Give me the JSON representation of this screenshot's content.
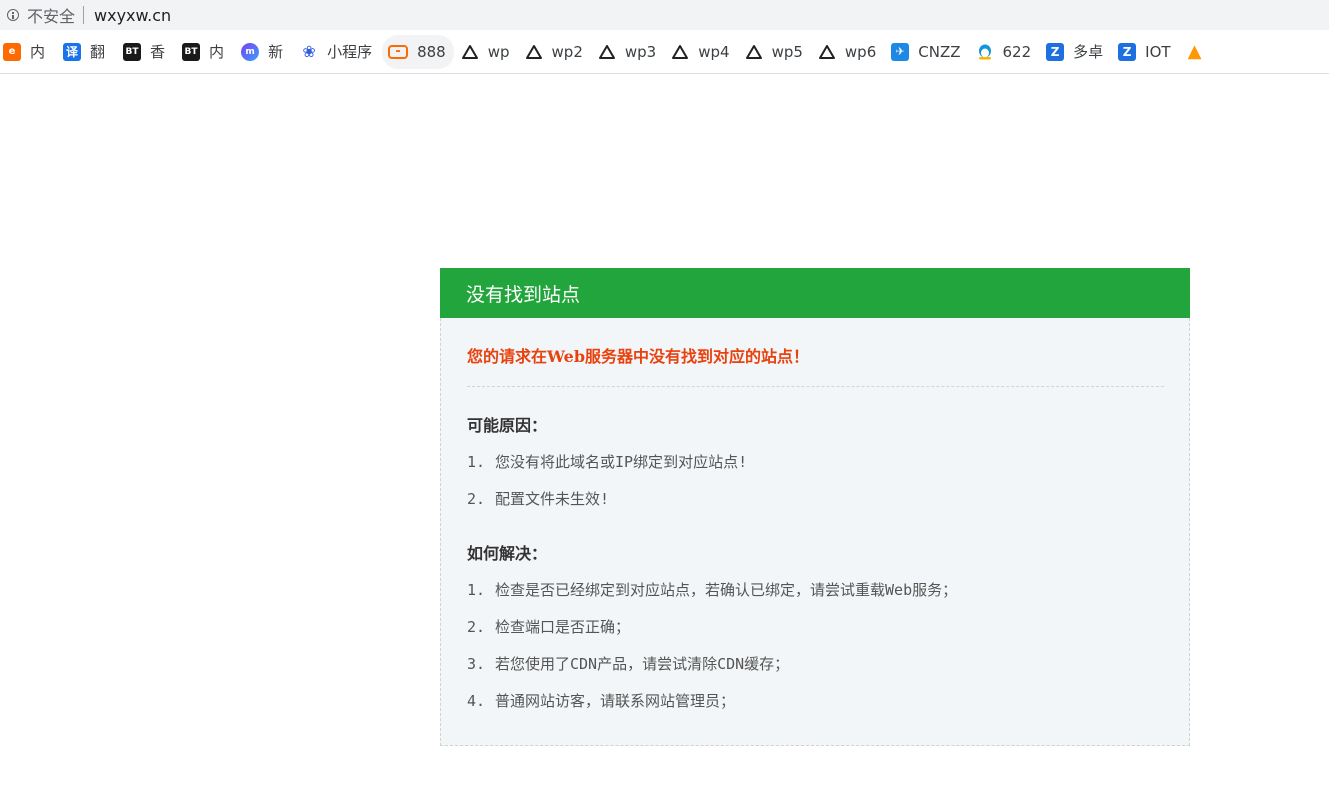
{
  "addressbar": {
    "security_label": "不安全",
    "url": "wxyxw.cn"
  },
  "bookmarks": [
    {
      "icon": "alibaba-icon",
      "label": "内"
    },
    {
      "icon": "translate-icon",
      "label": "翻"
    },
    {
      "icon": "bt-icon",
      "label": "香"
    },
    {
      "icon": "bt-icon",
      "label": "内"
    },
    {
      "icon": "xin-icon",
      "label": "新"
    },
    {
      "icon": "baidu-paw-icon",
      "label": "小程序"
    },
    {
      "icon": "aliyun-icon",
      "label": "888"
    },
    {
      "icon": "triangle-icon",
      "label": "wp"
    },
    {
      "icon": "triangle-icon",
      "label": "wp2"
    },
    {
      "icon": "triangle-icon",
      "label": "wp3"
    },
    {
      "icon": "triangle-icon",
      "label": "wp4"
    },
    {
      "icon": "triangle-icon",
      "label": "wp5"
    },
    {
      "icon": "triangle-icon",
      "label": "wp6"
    },
    {
      "icon": "cnzz-icon",
      "label": "CNZZ"
    },
    {
      "icon": "qq-penguin-icon",
      "label": "622"
    },
    {
      "icon": "z-icon",
      "label": "多卓"
    },
    {
      "icon": "z-icon",
      "label": "IOT"
    },
    {
      "icon": "a-logo-icon",
      "label": ""
    }
  ],
  "error": {
    "title": "没有找到站点",
    "message": "您的请求在Web服务器中没有找到对应的站点！",
    "reasons_title": "可能原因：",
    "reasons": [
      {
        "num": "1.",
        "text": "您没有将此域名或IP绑定到对应站点!"
      },
      {
        "num": "2.",
        "text": "配置文件未生效!"
      }
    ],
    "solutions_title": "如何解决：",
    "solutions": [
      {
        "num": "1.",
        "text": "检查是否已经绑定到对应站点，若确认已绑定，请尝试重载Web服务；"
      },
      {
        "num": "2.",
        "text": "检查端口是否正确；"
      },
      {
        "num": "3.",
        "text": "若您使用了CDN产品，请尝试清除CDN缓存；"
      },
      {
        "num": "4.",
        "text": "普通网站访客，请联系网站管理员；"
      }
    ]
  },
  "colors": {
    "header_green": "#21a53c",
    "error_red": "#e8420f",
    "box_bg": "#f3f6f8"
  }
}
